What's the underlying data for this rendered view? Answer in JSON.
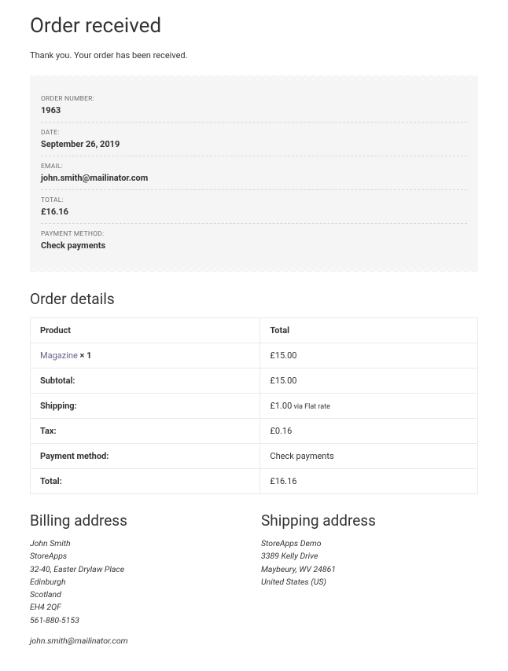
{
  "title": "Order received",
  "intro": "Thank you. Your order has been received.",
  "summary": [
    {
      "label": "ORDER NUMBER:",
      "value": "1963"
    },
    {
      "label": "DATE:",
      "value": "September 26, 2019"
    },
    {
      "label": "EMAIL:",
      "value": "john.smith@mailinator.com"
    },
    {
      "label": "TOTAL:",
      "value": "£16.16"
    },
    {
      "label": "PAYMENT METHOD:",
      "value": "Check payments"
    }
  ],
  "order_details_heading": "Order details",
  "table": {
    "head": {
      "product": "Product",
      "total": "Total"
    },
    "items": [
      {
        "name": "Magazine",
        "qty": "× 1",
        "total": "£15.00"
      }
    ],
    "foot": [
      {
        "label": "Subtotal:",
        "value": "£15.00",
        "small": ""
      },
      {
        "label": "Shipping:",
        "value": "£1.00",
        "small": "via Flat rate"
      },
      {
        "label": "Tax:",
        "value": "£0.16",
        "small": ""
      },
      {
        "label": "Payment method:",
        "value": "Check payments",
        "small": ""
      },
      {
        "label": "Total:",
        "value": "£16.16",
        "small": ""
      }
    ]
  },
  "billing": {
    "heading": "Billing address",
    "lines": [
      "John Smith",
      "StoreApps",
      "32-40, Easter Drylaw Place",
      "Edinburgh",
      "Scotland",
      "EH4 2QF",
      "561-880-5153"
    ],
    "email": "john.smith@mailinator.com"
  },
  "shipping": {
    "heading": "Shipping address",
    "lines": [
      "StoreApps Demo",
      "3389 Kelly Drive",
      "Maybeury, WV 24861",
      "United States (US)"
    ]
  }
}
